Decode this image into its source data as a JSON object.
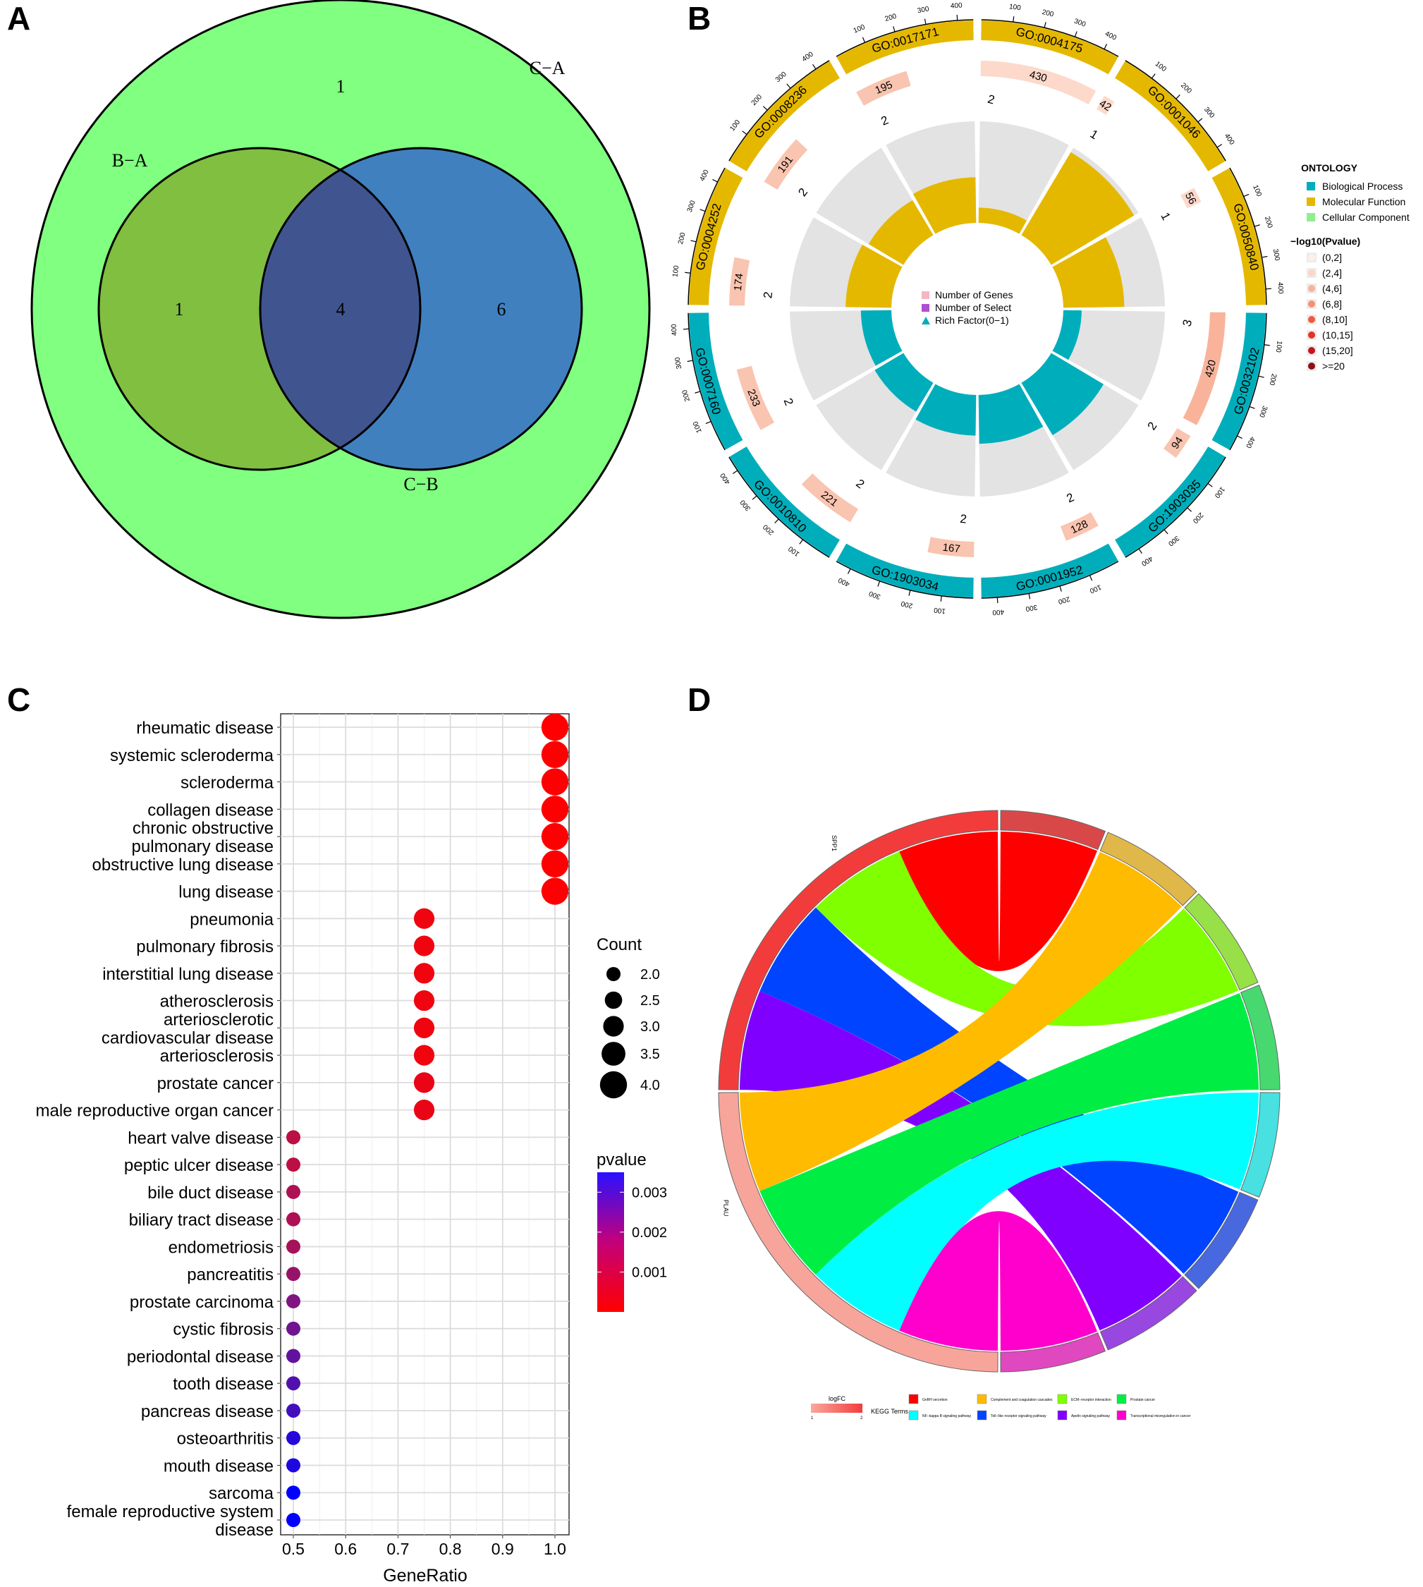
{
  "panels": {
    "a": "A",
    "b": "B",
    "c": "C",
    "d": "D"
  },
  "chart_data": [
    {
      "type": "venn",
      "panel": "A",
      "sets": [
        {
          "name": "C−A",
          "color": "#80ff80"
        },
        {
          "name": "B−A",
          "color": "#80bf40"
        },
        {
          "name": "C−B",
          "color": "#4080bf"
        }
      ],
      "regions": {
        "outer_only": "1",
        "ba_only": "1",
        "intersection": "4",
        "cb_only": "6"
      },
      "intersection_color": "#40558f"
    },
    {
      "type": "circular-go",
      "panel": "B",
      "colors": {
        "Biological Process": "#00aebb",
        "Molecular Function": "#e5b800",
        "Cellular Component": "#90ee90"
      },
      "outer_ticks": [
        100,
        200,
        300,
        400
      ],
      "terms": [
        {
          "id": "GO:0004175",
          "ontology": "Molecular Function",
          "genes": 430,
          "select": 2,
          "rich": 0.15,
          "gene_color": "#fdd9cb"
        },
        {
          "id": "GO:0001046",
          "ontology": "Molecular Function",
          "genes": 42,
          "select": 1,
          "rich": 0.95,
          "gene_color": "#fdd9cb"
        },
        {
          "id": "GO:0050840",
          "ontology": "Molecular Function",
          "genes": 56,
          "select": 1,
          "rich": 0.6,
          "gene_color": "#fdd9cb"
        },
        {
          "id": "GO:0032102",
          "ontology": "Biological Process",
          "genes": 420,
          "select": 3,
          "rich": 0.18,
          "gene_color": "#f9b39b"
        },
        {
          "id": "GO:1903035",
          "ontology": "Biological Process",
          "genes": 94,
          "select": 2,
          "rich": 0.6,
          "gene_color": "#f9c4b0"
        },
        {
          "id": "GO:0001952",
          "ontology": "Biological Process",
          "genes": 128,
          "select": 2,
          "rich": 0.48,
          "gene_color": "#f9c4b0"
        },
        {
          "id": "GO:1903034",
          "ontology": "Biological Process",
          "genes": 167,
          "select": 2,
          "rich": 0.4,
          "gene_color": "#f9c4b0"
        },
        {
          "id": "GO:0010810",
          "ontology": "Biological Process",
          "genes": 221,
          "select": 2,
          "rich": 0.33,
          "gene_color": "#f9c4b0"
        },
        {
          "id": "GO:0007160",
          "ontology": "Biological Process",
          "genes": 233,
          "select": 2,
          "rich": 0.3,
          "gene_color": "#f9c4b0"
        },
        {
          "id": "GO:0004252",
          "ontology": "Molecular Function",
          "genes": 174,
          "select": 2,
          "rich": 0.45,
          "gene_color": "#f9c4b0"
        },
        {
          "id": "GO:0008236",
          "ontology": "Molecular Function",
          "genes": 191,
          "select": 2,
          "rich": 0.4,
          "gene_color": "#f9c4b0"
        },
        {
          "id": "GO:0017171",
          "ontology": "Molecular Function",
          "genes": 195,
          "select": 2,
          "rich": 0.45,
          "gene_color": "#f9c4b0"
        }
      ],
      "inner_legend": [
        {
          "label": "Number of Genes",
          "color": "#f4b6c2"
        },
        {
          "label": "Number of Select",
          "color": "#b04fd0"
        },
        {
          "label": "Rich Factor(0−1)",
          "color": "#00aebb"
        }
      ],
      "legend": {
        "ontology_title": "ONTOLOGY",
        "ontology_items": [
          "Biological Process",
          "Molecular Function",
          "Cellular Component"
        ],
        "pvalue_title": "−log10(Pvalue)",
        "pvalue_items": [
          {
            "label": "(0,2]",
            "color": "#fdf0e8"
          },
          {
            "label": "(2,4]",
            "color": "#fcd5c5"
          },
          {
            "label": "(4,6]",
            "color": "#f9b39b"
          },
          {
            "label": "(6,8]",
            "color": "#f58f75"
          },
          {
            "label": "(8,10]",
            "color": "#ef5a3f"
          },
          {
            "label": "(10,15]",
            "color": "#e63222"
          },
          {
            "label": "(15,20]",
            "color": "#c8141a"
          },
          {
            "label": ">=20",
            "color": "#8e0f14"
          }
        ]
      }
    },
    {
      "type": "scatter",
      "panel": "C",
      "xlabel": "GeneRatio",
      "xlim": [
        0.475,
        1.025
      ],
      "xticks": [
        "0.5",
        "0.6",
        "0.7",
        "0.8",
        "0.9",
        "1.0"
      ],
      "grid": true,
      "size_legend": {
        "title": "Count",
        "values": [
          "2.0",
          "2.5",
          "3.0",
          "3.5",
          "4.0"
        ]
      },
      "color_legend": {
        "title": "pvalue",
        "ticks": [
          "0.001",
          "0.002",
          "0.003"
        ],
        "range": [
          0,
          0.0034
        ],
        "low": "#ff0000",
        "high": "#0000ff"
      },
      "points": [
        {
          "term": "rheumatic disease",
          "ratio": 1.0,
          "count": 4,
          "p": 2e-05
        },
        {
          "term": "systemic scleroderma",
          "ratio": 1.0,
          "count": 4,
          "p": 2e-05
        },
        {
          "term": "scleroderma",
          "ratio": 1.0,
          "count": 4,
          "p": 2e-05
        },
        {
          "term": "collagen disease",
          "ratio": 1.0,
          "count": 4,
          "p": 2e-05
        },
        {
          "term": "chronic obstructive\npulmonary disease",
          "ratio": 1.0,
          "count": 4,
          "p": 2e-05
        },
        {
          "term": "obstructive lung disease",
          "ratio": 1.0,
          "count": 4,
          "p": 2e-05
        },
        {
          "term": "lung disease",
          "ratio": 1.0,
          "count": 4,
          "p": 2e-05
        },
        {
          "term": "pneumonia",
          "ratio": 0.75,
          "count": 3,
          "p": 0.0002
        },
        {
          "term": "pulmonary fibrosis",
          "ratio": 0.75,
          "count": 3,
          "p": 0.0002
        },
        {
          "term": "interstitial lung disease",
          "ratio": 0.75,
          "count": 3,
          "p": 0.0002
        },
        {
          "term": "atherosclerosis",
          "ratio": 0.75,
          "count": 3,
          "p": 0.0002
        },
        {
          "term": "arteriosclerotic\ncardiovascular disease",
          "ratio": 0.75,
          "count": 3,
          "p": 0.0002
        },
        {
          "term": "arteriosclerosis",
          "ratio": 0.75,
          "count": 3,
          "p": 0.0002
        },
        {
          "term": "prostate cancer",
          "ratio": 0.75,
          "count": 3,
          "p": 0.0003
        },
        {
          "term": "male reproductive organ cancer",
          "ratio": 0.75,
          "count": 3,
          "p": 0.0003
        },
        {
          "term": "heart valve disease",
          "ratio": 0.5,
          "count": 2,
          "p": 0.0009
        },
        {
          "term": "peptic ulcer disease",
          "ratio": 0.5,
          "count": 2,
          "p": 0.0009
        },
        {
          "term": "bile duct disease",
          "ratio": 0.5,
          "count": 2,
          "p": 0.0011
        },
        {
          "term": "biliary tract disease",
          "ratio": 0.5,
          "count": 2,
          "p": 0.0011
        },
        {
          "term": "endometriosis",
          "ratio": 0.5,
          "count": 2,
          "p": 0.0012
        },
        {
          "term": "pancreatitis",
          "ratio": 0.5,
          "count": 2,
          "p": 0.0014
        },
        {
          "term": "prostate carcinoma",
          "ratio": 0.5,
          "count": 2,
          "p": 0.0017
        },
        {
          "term": "cystic fibrosis",
          "ratio": 0.5,
          "count": 2,
          "p": 0.0019
        },
        {
          "term": "periodontal disease",
          "ratio": 0.5,
          "count": 2,
          "p": 0.0021
        },
        {
          "term": "tooth disease",
          "ratio": 0.5,
          "count": 2,
          "p": 0.0023
        },
        {
          "term": "pancreas disease",
          "ratio": 0.5,
          "count": 2,
          "p": 0.0025
        },
        {
          "term": "osteoarthritis",
          "ratio": 0.5,
          "count": 2,
          "p": 0.0029
        },
        {
          "term": "mouth disease",
          "ratio": 0.5,
          "count": 2,
          "p": 0.003
        },
        {
          "term": "sarcoma",
          "ratio": 0.5,
          "count": 2,
          "p": 0.0034
        },
        {
          "term": "female reproductive system\ndisease",
          "ratio": 0.5,
          "count": 2,
          "p": 0.0034
        }
      ]
    },
    {
      "type": "chord",
      "panel": "D",
      "genes": [
        {
          "name": "SPP1",
          "logFC": 2,
          "color": "#f23c3c"
        },
        {
          "name": "PLAU",
          "logFC": 1,
          "color": "#f7a59b"
        }
      ],
      "terms": [
        {
          "name": "GnRH secretion",
          "color": "#ff0000",
          "ring": "#d94848"
        },
        {
          "name": "Complement and coagulation cascades",
          "color": "#ffbb00",
          "ring": "#e0b84a"
        },
        {
          "name": "ECM−receptor interaction",
          "color": "#80ff00",
          "ring": "#98e048"
        },
        {
          "name": "Prostate cancer",
          "color": "#00ee44",
          "ring": "#48d870"
        },
        {
          "name": "NF−kappa B signaling pathway",
          "color": "#00ffff",
          "ring": "#48e0e0"
        },
        {
          "name": "Toll−like receptor signaling pathway",
          "color": "#0044ff",
          "ring": "#4868e0"
        },
        {
          "name": "Apelin signaling pathway",
          "color": "#8000ff",
          "ring": "#9848e0"
        },
        {
          "name": "Transcriptional misregulation in cancer",
          "color": "#ff00cc",
          "ring": "#e048c0"
        }
      ],
      "links": [
        [
          "SPP1",
          "GnRH secretion"
        ],
        [
          "SPP1",
          "ECM−receptor interaction"
        ],
        [
          "SPP1",
          "Toll−like receptor signaling pathway"
        ],
        [
          "SPP1",
          "Apelin signaling pathway"
        ],
        [
          "PLAU",
          "Complement and coagulation cascades"
        ],
        [
          "PLAU",
          "Prostate cancer"
        ],
        [
          "PLAU",
          "NF−kappa B signaling pathway"
        ],
        [
          "PLAU",
          "Transcriptional misregulation in cancer"
        ]
      ],
      "legend": {
        "logfc_title": "logFC",
        "logfc_min": "1",
        "logfc_max": "2",
        "terms_title": "KEGG Terms"
      }
    }
  ]
}
